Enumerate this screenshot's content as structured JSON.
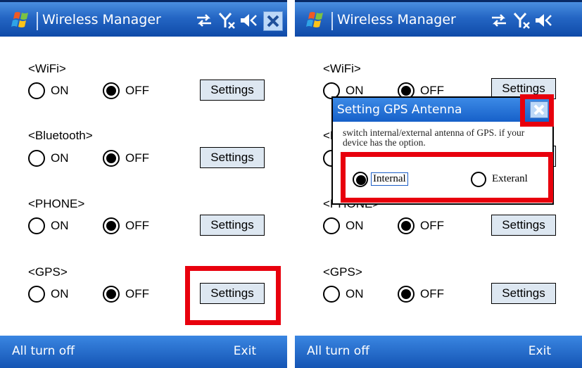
{
  "app_title": "Wireless Manager",
  "groups": [
    {
      "label": "<WiFi>",
      "on_label": "ON",
      "off_label": "OFF",
      "button": "Settings"
    },
    {
      "label": "<Bluetooth>",
      "on_label": "ON",
      "off_label": "OFF",
      "button": "Settings"
    },
    {
      "label": "<PHONE>",
      "on_label": "ON",
      "off_label": "OFF",
      "button": "Settings"
    },
    {
      "label": "<GPS>",
      "on_label": "ON",
      "off_label": "OFF",
      "button": "Settings"
    }
  ],
  "softkeys": {
    "left": "All turn off",
    "right": "Exit"
  },
  "dialog": {
    "title": "Setting GPS Antenna",
    "description": "switch internal/external antenna of GPS. if your device has the option.",
    "option_internal": "Internal",
    "option_external": "Exteranl",
    "selected": "Internal"
  },
  "icons": {
    "logo": "windows-flag-icon",
    "connectivity": "sync-arrows-icon",
    "signal": "no-signal-icon",
    "volume": "speaker-muted-icon",
    "close": "close-icon"
  },
  "colors": {
    "titlebar": "#1f5fc0",
    "highlight": "#e8000d",
    "button_face": "#dde7f1"
  }
}
